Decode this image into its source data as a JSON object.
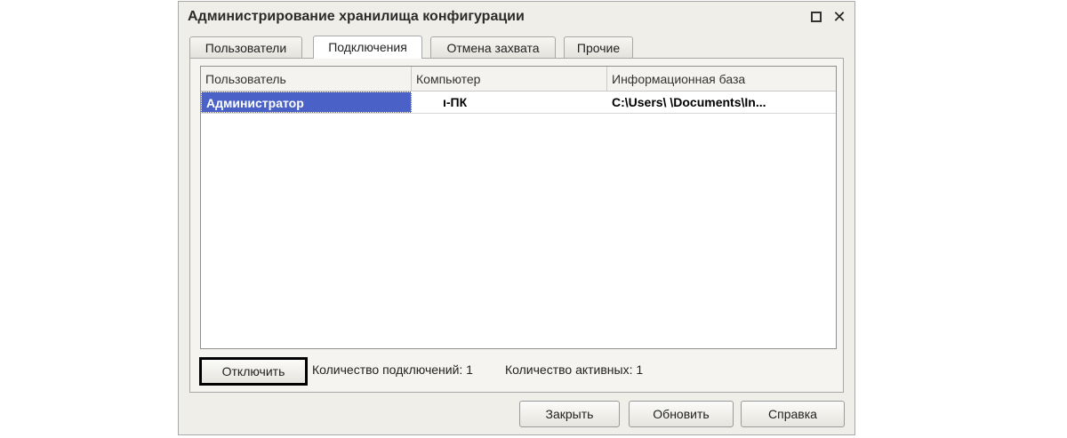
{
  "window": {
    "title": "Администрирование хранилища конфигурации"
  },
  "tabs": [
    {
      "label": "Пользователи"
    },
    {
      "label": "Подключения"
    },
    {
      "label": "Отмена захвата"
    },
    {
      "label": "Прочие"
    }
  ],
  "active_tab": "Подключения",
  "table": {
    "columns": [
      "Пользователь",
      "Компьютер",
      "Информационная база"
    ],
    "rows": [
      {
        "user": "Администратор",
        "computer": "ı-ПК",
        "infobase": "C:\\Users\\        \\Documents\\In..."
      }
    ]
  },
  "panel": {
    "disconnect_label": "Отключить",
    "connections_count": "Количество подключений: 1",
    "active_count": "Количество активных: 1"
  },
  "footer": {
    "close_label": "Закрыть",
    "refresh_label": "Обновить",
    "help_label": "Справка"
  },
  "icons": {
    "maximize": "maximize-icon",
    "close": "close-icon"
  },
  "colors": {
    "selection": "#4a61c7",
    "window_bg": "#f0eee8"
  }
}
